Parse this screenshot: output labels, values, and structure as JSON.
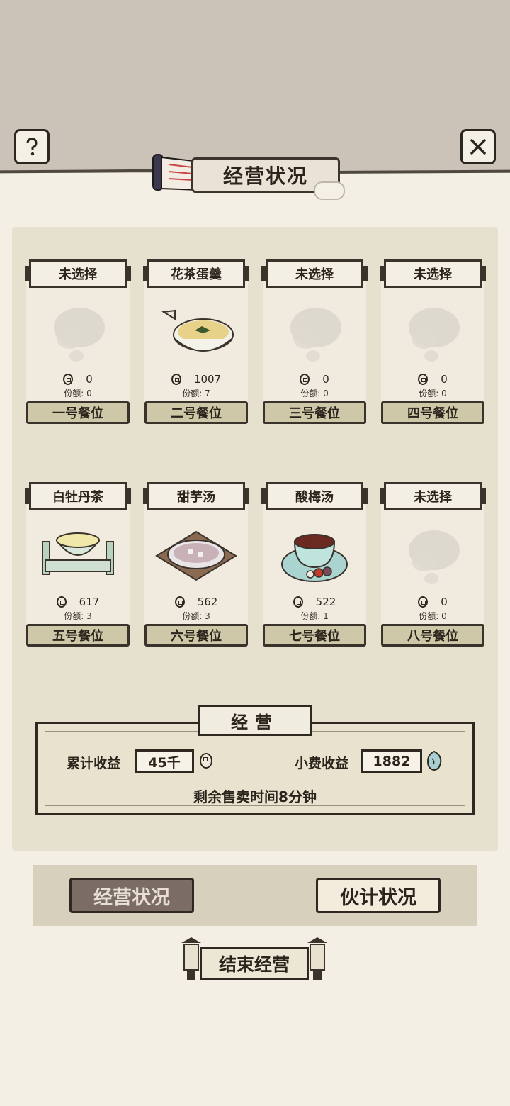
{
  "header": {
    "title": "经营状况"
  },
  "slots": [
    {
      "dish": "未选择",
      "price": "0",
      "share": "份额: 0",
      "label": "一号餐位",
      "icon": "empty-smoke"
    },
    {
      "dish": "花茶蛋羹",
      "price": "1007",
      "share": "份额: 7",
      "label": "二号餐位",
      "icon": "egg-custard-bowl"
    },
    {
      "dish": "未选择",
      "price": "0",
      "share": "份额: 0",
      "label": "三号餐位",
      "icon": "empty-smoke"
    },
    {
      "dish": "未选择",
      "price": "0",
      "share": "份额: 0",
      "label": "四号餐位",
      "icon": "empty-smoke"
    },
    {
      "dish": "白牡丹茶",
      "price": "617",
      "share": "份额: 3",
      "label": "五号餐位",
      "icon": "tea-cup-tray"
    },
    {
      "dish": "甜芋汤",
      "price": "562",
      "share": "份额: 3",
      "label": "六号餐位",
      "icon": "taro-soup-plate"
    },
    {
      "dish": "酸梅汤",
      "price": "522",
      "share": "份额: 1",
      "label": "七号餐位",
      "icon": "plum-soup-cup"
    },
    {
      "dish": "未选择",
      "price": "0",
      "share": "份额: 0",
      "label": "八号餐位",
      "icon": "empty-smoke"
    }
  ],
  "business": {
    "title": "经营",
    "total_label": "累计收益",
    "total_value": "45千",
    "tip_label": "小费收益",
    "tip_value": "1882",
    "remaining": "剩余售卖时间8分钟"
  },
  "tabs": {
    "ops": "经营状况",
    "staff": "伙计状况"
  },
  "end_button": "结束经营",
  "colors": {
    "background": "#f3efe5",
    "top_band": "#cbc2b8",
    "panel": "#e6e0cf",
    "active_tab": "#7b6c66"
  }
}
